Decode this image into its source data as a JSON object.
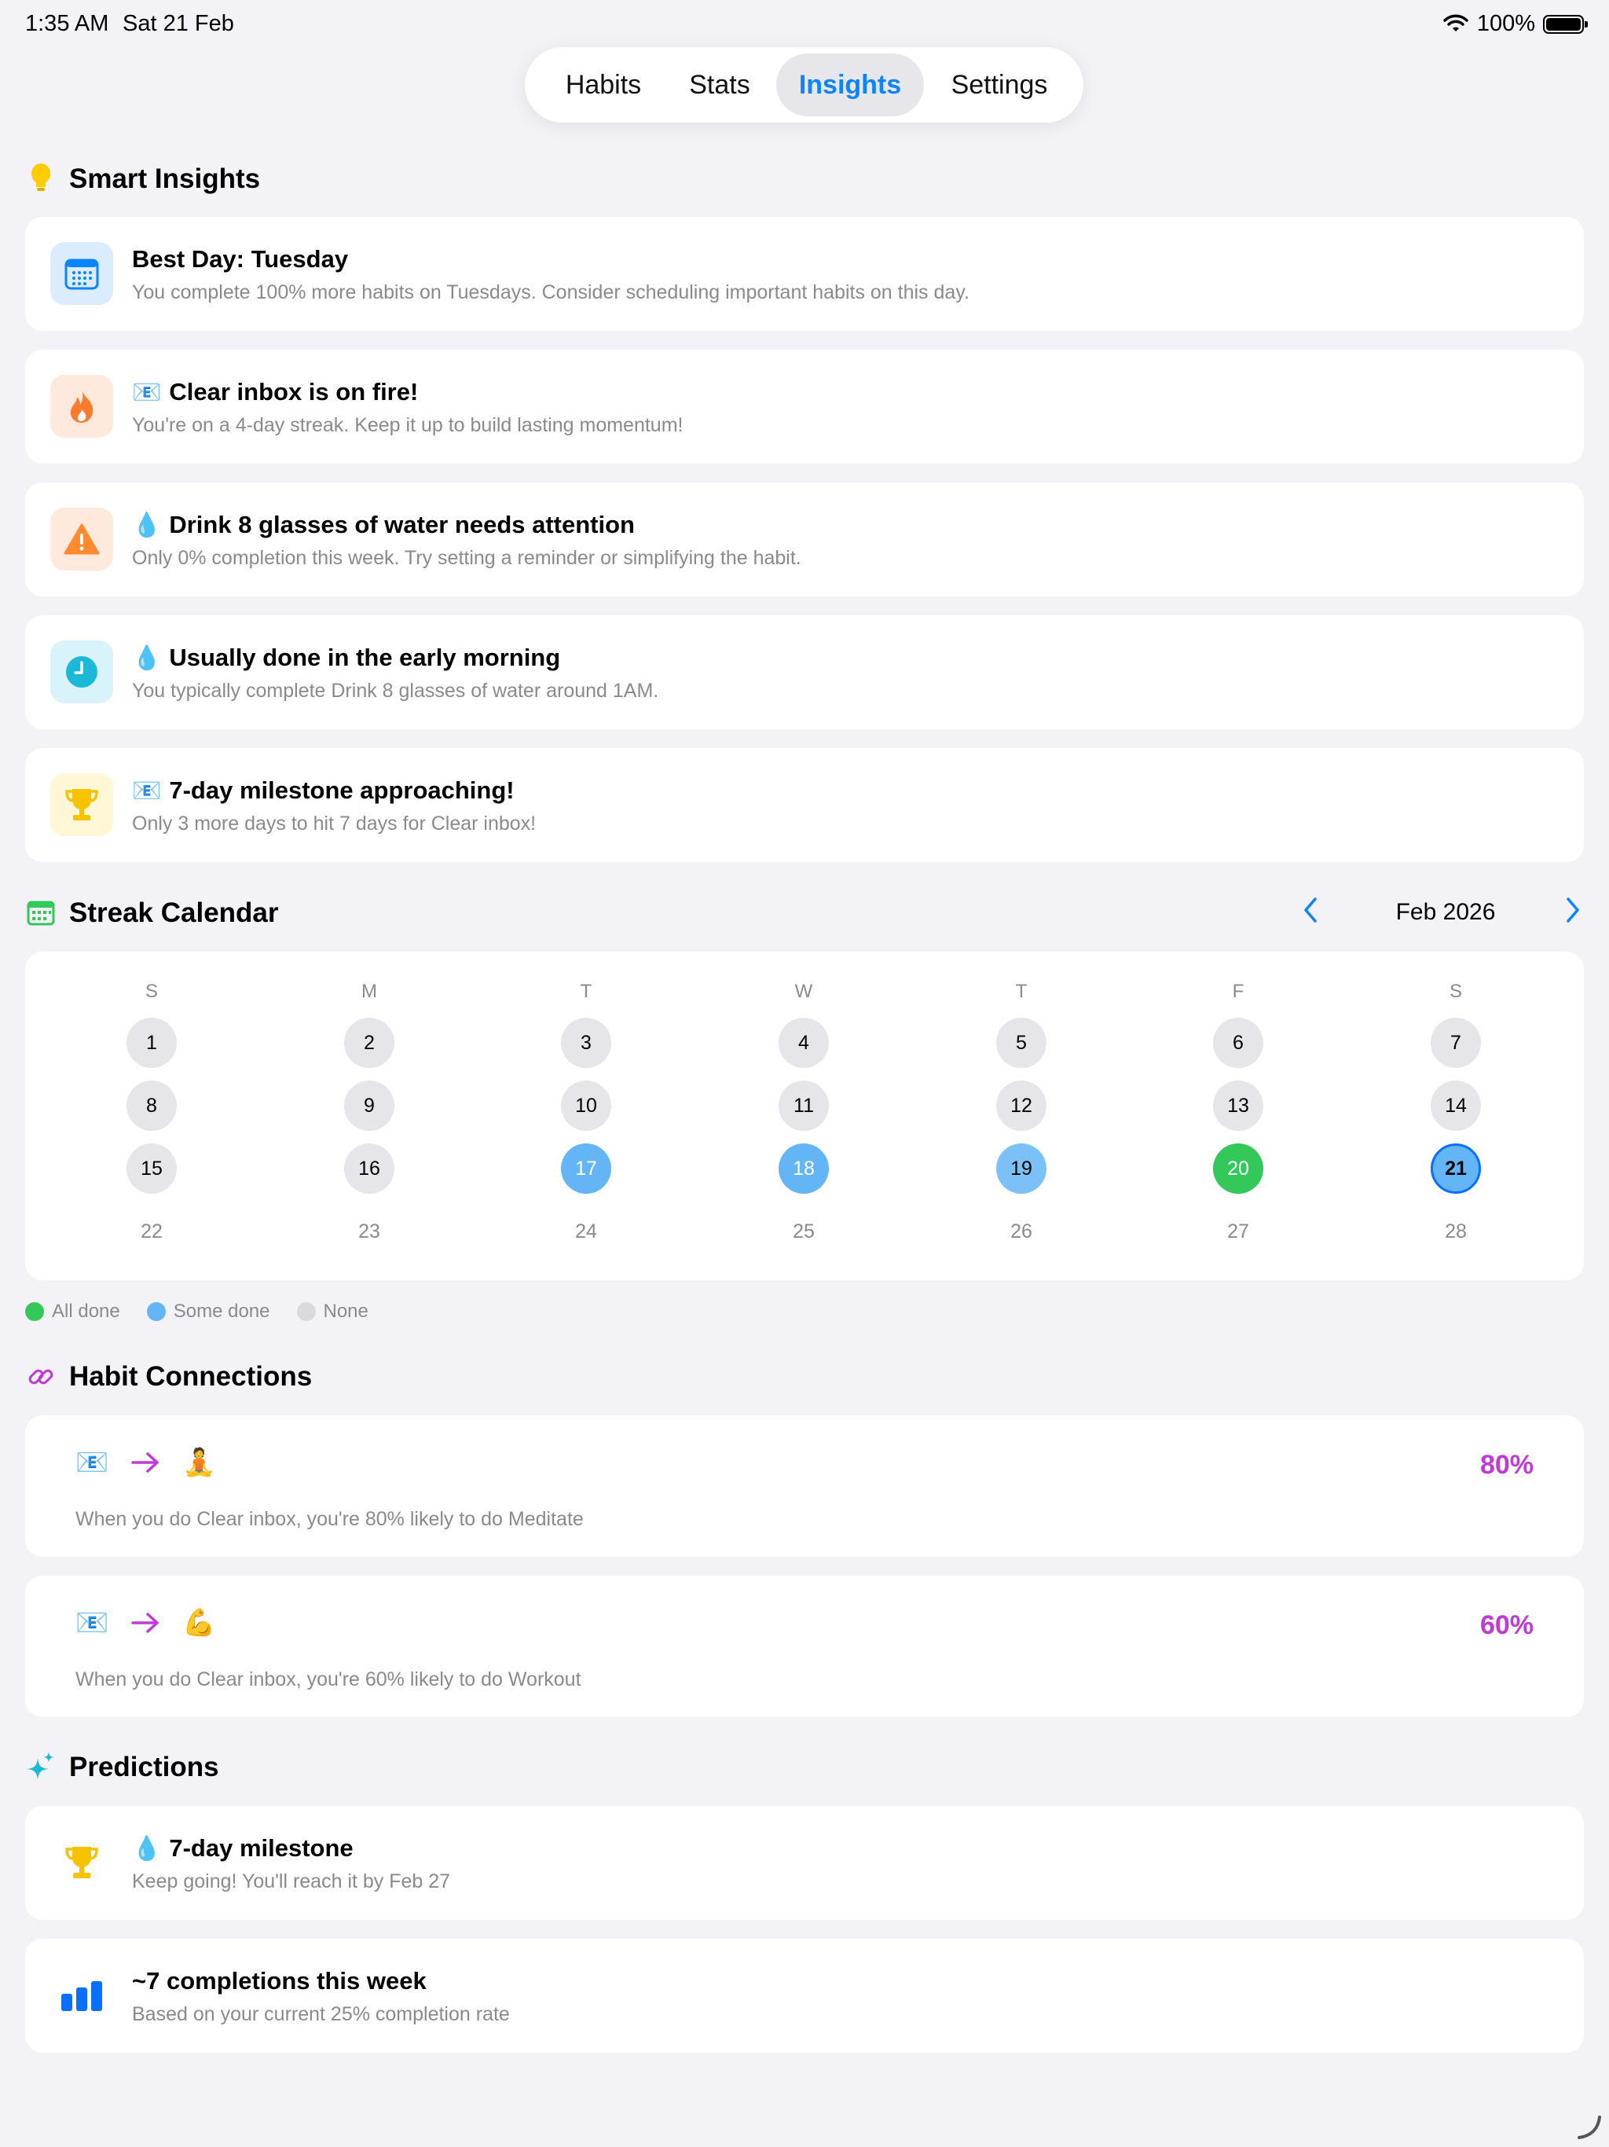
{
  "status": {
    "time": "1:35 AM",
    "date": "Sat 21 Feb",
    "battery": "100%"
  },
  "tabs": [
    {
      "label": "Habits"
    },
    {
      "label": "Stats"
    },
    {
      "label": "Insights",
      "active": true
    },
    {
      "label": "Settings"
    }
  ],
  "smart_insights": {
    "title": "Smart Insights",
    "icon": "lightbulb-icon",
    "cards": [
      {
        "icon": "calendar-icon",
        "emoji": "",
        "title": "Best Day: Tuesday",
        "subtitle": "You complete 100% more habits on Tuesdays. Consider scheduling important habits on this day."
      },
      {
        "icon": "flame-icon",
        "emoji": "📧",
        "title": "Clear inbox is on fire!",
        "subtitle": "You're on a 4-day streak. Keep it up to build lasting momentum!"
      },
      {
        "icon": "warning-icon",
        "emoji": "💧",
        "title": "Drink 8 glasses of water needs attention",
        "subtitle": "Only 0% completion this week. Try setting a reminder or simplifying the habit."
      },
      {
        "icon": "clock-icon",
        "emoji": "💧",
        "title": "Usually done in the early morning",
        "subtitle": "You typically complete Drink 8 glasses of water around 1AM."
      },
      {
        "icon": "trophy-icon",
        "emoji": "📧",
        "title": "7-day milestone approaching!",
        "subtitle": "Only 3 more days to hit 7 days for Clear inbox!"
      }
    ]
  },
  "streak_calendar": {
    "title": "Streak Calendar",
    "month": "Feb 2026",
    "weekdays": [
      "S",
      "M",
      "T",
      "W",
      "T",
      "F",
      "S"
    ],
    "weeks": [
      [
        {
          "d": "1",
          "s": "none"
        },
        {
          "d": "2",
          "s": "none"
        },
        {
          "d": "3",
          "s": "none"
        },
        {
          "d": "4",
          "s": "none"
        },
        {
          "d": "5",
          "s": "none"
        },
        {
          "d": "6",
          "s": "none"
        },
        {
          "d": "7",
          "s": "none"
        }
      ],
      [
        {
          "d": "8",
          "s": "none"
        },
        {
          "d": "9",
          "s": "none"
        },
        {
          "d": "10",
          "s": "none"
        },
        {
          "d": "11",
          "s": "none"
        },
        {
          "d": "12",
          "s": "none"
        },
        {
          "d": "13",
          "s": "none"
        },
        {
          "d": "14",
          "s": "none"
        }
      ],
      [
        {
          "d": "15",
          "s": "none"
        },
        {
          "d": "16",
          "s": "none"
        },
        {
          "d": "17",
          "s": "some"
        },
        {
          "d": "18",
          "s": "some"
        },
        {
          "d": "19",
          "s": "some-light"
        },
        {
          "d": "20",
          "s": "all"
        },
        {
          "d": "21",
          "s": "today"
        }
      ],
      [
        {
          "d": "22",
          "s": "future"
        },
        {
          "d": "23",
          "s": "future"
        },
        {
          "d": "24",
          "s": "future"
        },
        {
          "d": "25",
          "s": "future"
        },
        {
          "d": "26",
          "s": "future"
        },
        {
          "d": "27",
          "s": "future"
        },
        {
          "d": "28",
          "s": "future"
        }
      ]
    ],
    "legend": [
      {
        "label": "All done",
        "color": "#34c759"
      },
      {
        "label": "Some done",
        "color": "#64b5f6"
      },
      {
        "label": "None",
        "color": "#d9d9de"
      }
    ]
  },
  "habit_connections": {
    "title": "Habit Connections",
    "items": [
      {
        "from": "📧",
        "to": "🧘",
        "percent": "80%",
        "description": "When you do Clear inbox, you're 80% likely to do Meditate"
      },
      {
        "from": "📧",
        "to": "💪",
        "percent": "60%",
        "description": "When you do Clear inbox, you're 60% likely to do Workout"
      }
    ]
  },
  "predictions": {
    "title": "Predictions",
    "items": [
      {
        "icon": "trophy-icon",
        "emoji": "💧",
        "title": "7-day milestone",
        "subtitle": "Keep going! You'll reach it by Feb 27"
      },
      {
        "icon": "bar-chart-icon",
        "emoji": "",
        "title": "~7 completions this week",
        "subtitle": "Based on your current 25% completion rate"
      }
    ]
  },
  "colors": {
    "accent": "#0a84ff",
    "purple": "#c03ad6",
    "green": "#34c759",
    "blue": "#64b5f6"
  }
}
